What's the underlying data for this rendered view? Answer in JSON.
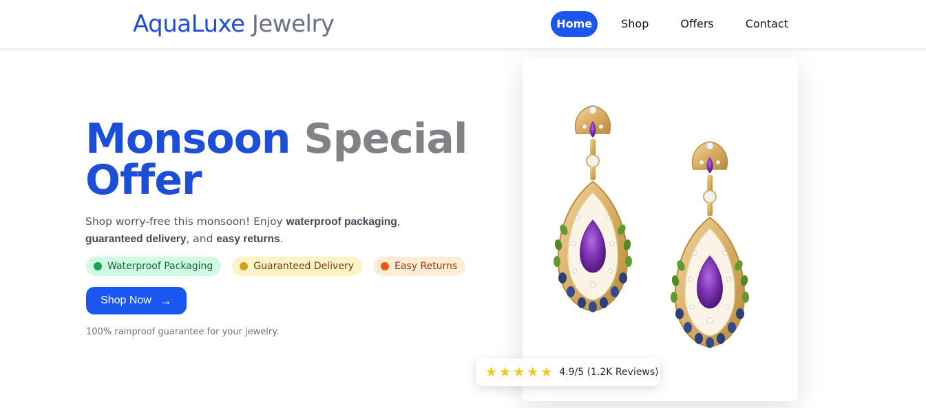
{
  "header": {
    "brand": "AquaLuxe",
    "brand_suffix": "Jewelry",
    "nav": [
      {
        "label": "Home",
        "active": true
      },
      {
        "label": "Shop",
        "active": false
      },
      {
        "label": "Offers",
        "active": false
      },
      {
        "label": "Contact",
        "active": false
      }
    ]
  },
  "hero": {
    "title_word1": "Monsoon",
    "title_word2": "Special",
    "title_line2": "Offer",
    "desc_prefix": "Shop worry-free this monsoon! Enjoy ",
    "desc_bold1": "waterproof packaging",
    "desc_sep1": ", ",
    "desc_bold2": "guaranteed delivery",
    "desc_sep2": ", and ",
    "desc_bold3": "easy returns",
    "desc_suffix": ".",
    "badges": [
      {
        "label": "Waterproof Packaging",
        "color": "#16a34a"
      },
      {
        "label": "Guaranteed Delivery",
        "color": "#d4a017"
      },
      {
        "label": "Easy Returns",
        "color": "#ea580c"
      }
    ],
    "cta_label": "Shop Now",
    "cta_icon": "arrow-right-icon",
    "guarantee": "100% rainproof guarantee for your jewelry."
  },
  "product": {
    "image": "amethyst-drop-earrings",
    "rating_stars": 5,
    "rating_text": "4.9/5 (1.2K Reviews)"
  },
  "colors": {
    "primary": "#1a56f0",
    "brand_blue": "#1d4ed8",
    "gray_text": "#808285",
    "star": "#f5c518"
  }
}
